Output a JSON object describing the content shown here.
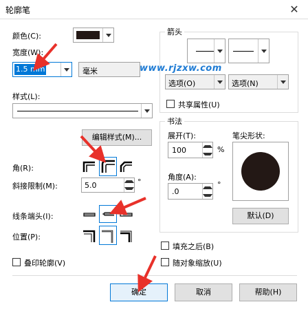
{
  "window": {
    "title": "轮廓笔",
    "close_glyph": "✕"
  },
  "color": {
    "label": "颜色(C):",
    "value_hex": "#231815"
  },
  "width": {
    "label": "宽度(W):",
    "value": "1.5 mm",
    "unit": "毫米"
  },
  "style": {
    "label": "样式(L):",
    "edit_button": "编辑样式(M)..."
  },
  "corners": {
    "label": "角(R):",
    "selected_index": 1
  },
  "miter": {
    "label": "斜接限制(M):",
    "value": "5.0",
    "unit": "°"
  },
  "line_caps": {
    "label": "线条端头(I):",
    "selected_index": 1
  },
  "position": {
    "label": "位置(P):",
    "selected_index": 1
  },
  "overprint": {
    "label": "叠印轮廓(V)",
    "checked": false
  },
  "arrows": {
    "group_title": "箭头",
    "options_left": "选项(O)",
    "options_right": "选项(N)",
    "share_attr_label": "共享属性(U)"
  },
  "calligraphy": {
    "group_title": "书法",
    "stretch_label": "展开(T):",
    "stretch_value": "100",
    "stretch_unit": "%",
    "angle_label": "角度(A):",
    "angle_value": ".0",
    "angle_unit": "°",
    "nib_label": "笔尖形状:",
    "default_button": "默认(D)"
  },
  "fill_behind": {
    "label": "填充之后(B)",
    "checked": false
  },
  "scale_with_object": {
    "label": "随对象缩放(U)",
    "checked": false
  },
  "buttons": {
    "ok": "确定",
    "cancel": "取消",
    "help": "帮助(H)"
  },
  "watermark": {
    "text": "www.rjzxw.com"
  },
  "colors": {
    "accent": "#0078d7",
    "annotation_red": "#e8312a",
    "watermark": "#1e7bd4"
  }
}
